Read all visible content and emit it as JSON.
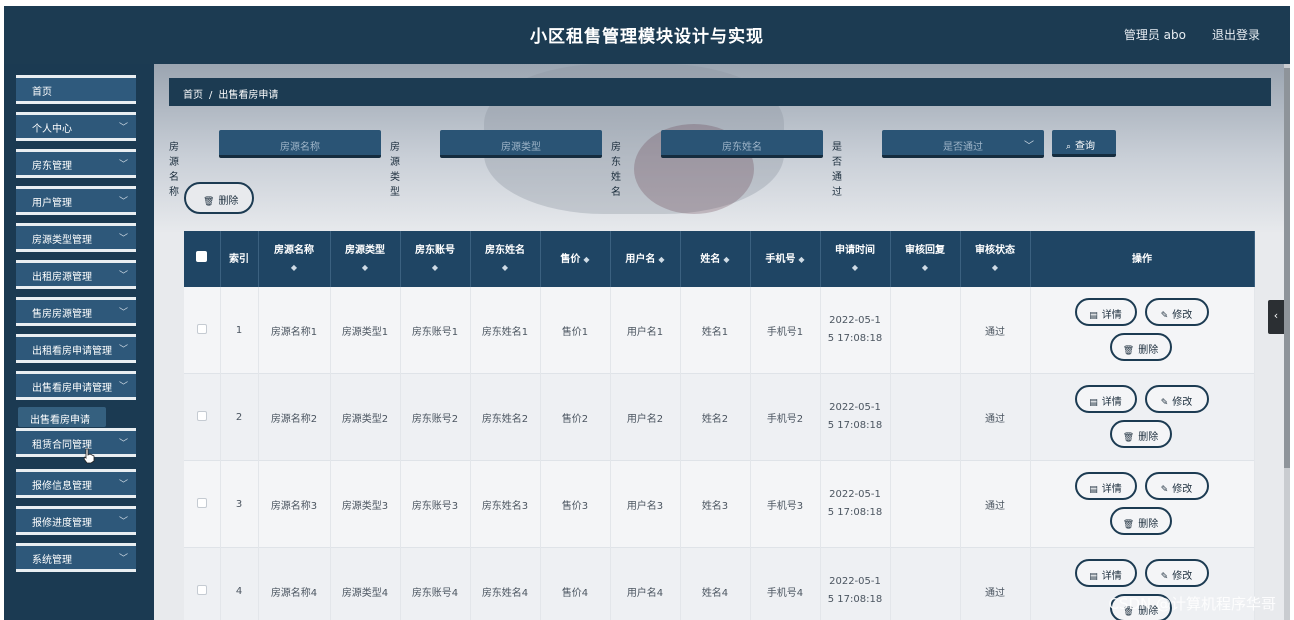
{
  "header": {
    "title": "小区租售管理模块设计与实现",
    "admin_label": "管理员 abo",
    "logout_label": "退出登录"
  },
  "sidebar": {
    "items": [
      {
        "label": "首页",
        "has_chevron": false
      },
      {
        "label": "个人中心",
        "has_chevron": true
      },
      {
        "label": "房东管理",
        "has_chevron": true
      },
      {
        "label": "用户管理",
        "has_chevron": true
      },
      {
        "label": "房源类型管理",
        "has_chevron": true
      },
      {
        "label": "出租房源管理",
        "has_chevron": true
      },
      {
        "label": "售房房源管理",
        "has_chevron": true
      },
      {
        "label": "出租看房申请管理",
        "has_chevron": true
      },
      {
        "label": "出售看房申请管理",
        "has_chevron": true
      },
      {
        "label": "租赁合同管理",
        "has_chevron": true
      },
      {
        "label": "报修信息管理",
        "has_chevron": true
      },
      {
        "label": "报修进度管理",
        "has_chevron": true
      },
      {
        "label": "系统管理",
        "has_chevron": true
      }
    ],
    "active_submenu": "出售看房申请"
  },
  "breadcrumb": {
    "home": "首页",
    "separator": "/",
    "current": "出售看房申请"
  },
  "filters": {
    "fields": [
      {
        "label": "房源名称",
        "placeholder": "房源名称"
      },
      {
        "label": "房源类型",
        "placeholder": "房源类型"
      },
      {
        "label": "房东姓名",
        "placeholder": "房东姓名"
      },
      {
        "label": "是否通过",
        "placeholder": "是否通过"
      }
    ],
    "search_label": "查询"
  },
  "bulk_delete_label": "删除",
  "table": {
    "columns": [
      "索引",
      "房源名称",
      "房源类型",
      "房东账号",
      "房东姓名",
      "售价",
      "用户名",
      "姓名",
      "手机号",
      "申请时间",
      "审核回复",
      "审核状态",
      "操作"
    ],
    "rows": [
      {
        "index": "1",
        "name": "房源名称1",
        "type": "房源类型1",
        "account": "房东账号1",
        "owner": "房东姓名1",
        "price": "售价1",
        "username": "用户名1",
        "realname": "姓名1",
        "phone": "手机号1",
        "time_a": "2022-05-1",
        "time_b": "5 17:08:18",
        "reply": "",
        "status": "通过"
      },
      {
        "index": "2",
        "name": "房源名称2",
        "type": "房源类型2",
        "account": "房东账号2",
        "owner": "房东姓名2",
        "price": "售价2",
        "username": "用户名2",
        "realname": "姓名2",
        "phone": "手机号2",
        "time_a": "2022-05-1",
        "time_b": "5 17:08:18",
        "reply": "",
        "status": "通过"
      },
      {
        "index": "3",
        "name": "房源名称3",
        "type": "房源类型3",
        "account": "房东账号3",
        "owner": "房东姓名3",
        "price": "售价3",
        "username": "用户名3",
        "realname": "姓名3",
        "phone": "手机号3",
        "time_a": "2022-05-1",
        "time_b": "5 17:08:18",
        "reply": "",
        "status": "通过"
      },
      {
        "index": "4",
        "name": "房源名称4",
        "type": "房源类型4",
        "account": "房东账号4",
        "owner": "房东姓名4",
        "price": "售价4",
        "username": "用户名4",
        "realname": "姓名4",
        "phone": "手机号4",
        "time_a": "2022-05-1",
        "time_b": "5 17:08:18",
        "reply": "",
        "status": "通过"
      }
    ],
    "actions": {
      "detail": "详情",
      "edit": "修改",
      "delete": "删除"
    }
  },
  "watermark": "CSDN @计算机程序华哥",
  "colors": {
    "header_bg": "#1c3b52",
    "accent": "#2a5475",
    "table_header": "#1f4564"
  }
}
